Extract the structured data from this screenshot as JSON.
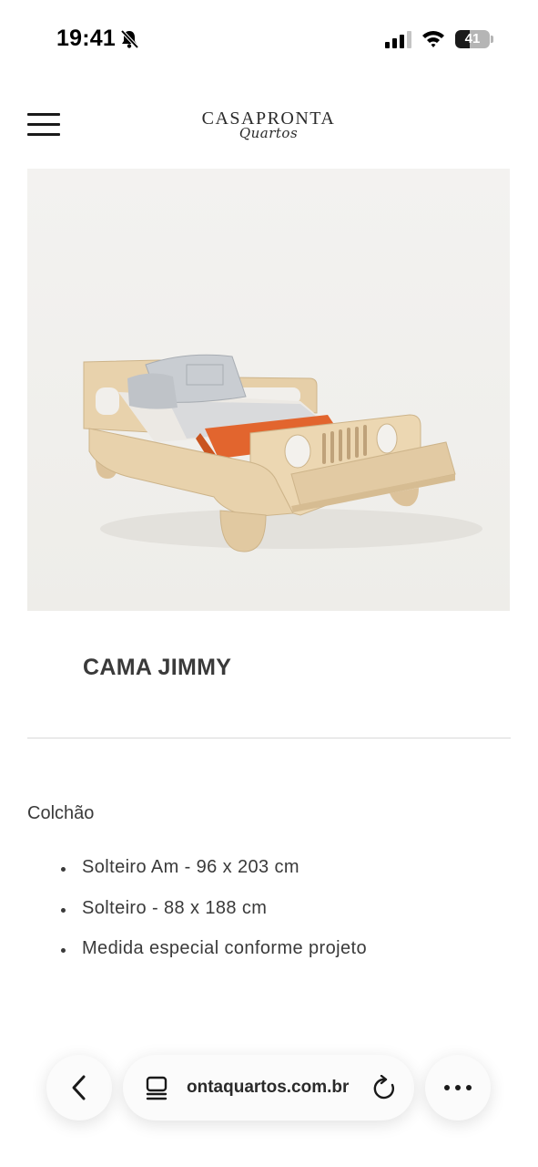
{
  "status_bar": {
    "time": "19:41",
    "battery_level": "41",
    "battery_fraction": 0.41,
    "icons": [
      "bell-slash-icon",
      "cellular-signal-icon",
      "wifi-icon",
      "battery-icon"
    ]
  },
  "header": {
    "logo_main": "CASAPRONTA",
    "logo_script": "Quartos",
    "menu_icon": "hamburger-menu-icon"
  },
  "product": {
    "image_subject": "wooden jeep-shaped toddler bed",
    "title": "CAMA JIMMY"
  },
  "description": {
    "heading": "Colchão",
    "items": [
      "Solteiro Am - 96 x 203 cm",
      "Solteiro - 88 x 188 cm",
      "Medida especial conforme projeto"
    ]
  },
  "browser": {
    "url_visible": "ontaquartos.com.br",
    "icons": [
      "back-chevron-icon",
      "reader-mode-icon",
      "reload-icon",
      "more-dots-icon"
    ]
  },
  "colors": {
    "wood": "#e2c9a2",
    "blanket_orange": "#e2652e",
    "image_bg": "#f1f0ee"
  }
}
